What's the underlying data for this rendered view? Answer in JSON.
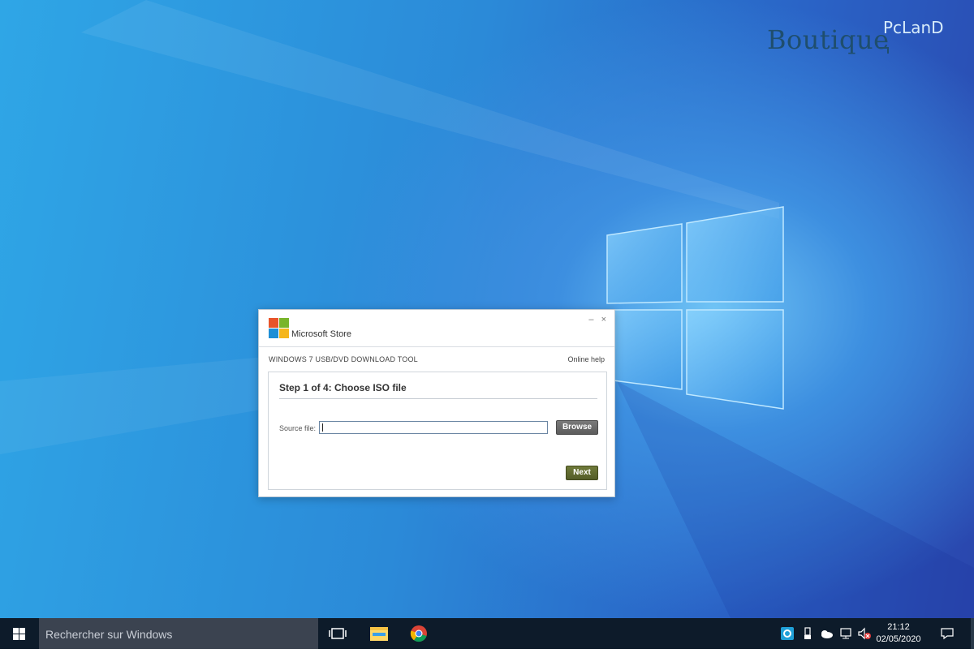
{
  "watermark": {
    "main": "Boutique",
    "accent": "PcLanD"
  },
  "dialog": {
    "brand": "Microsoft Store",
    "minimize_glyph": "–",
    "close_glyph": "×",
    "tool_title": "WINDOWS 7 USB/DVD DOWNLOAD TOOL",
    "online_help": "Online help",
    "step_title": "Step 1 of 4: Choose ISO file",
    "source_label": "Source file:",
    "source_value": "",
    "browse_label": "Browse",
    "next_label": "Next"
  },
  "taskbar": {
    "search_placeholder": "Rechercher sur Windows",
    "time": "21:12",
    "date": "02/05/2020",
    "pinned": [
      "task-view-icon",
      "file-explorer-icon",
      "chrome-icon"
    ],
    "tray": [
      "edge-icon",
      "usb-icon",
      "onedrive-icon",
      "network-icon",
      "volume-muted-icon",
      "notifications-icon"
    ]
  },
  "colors": {
    "desktop_accent": "#2b8ad8",
    "browse_button": "#666666",
    "next_button": "#5c6630",
    "taskbar": "#0d1b2a"
  }
}
